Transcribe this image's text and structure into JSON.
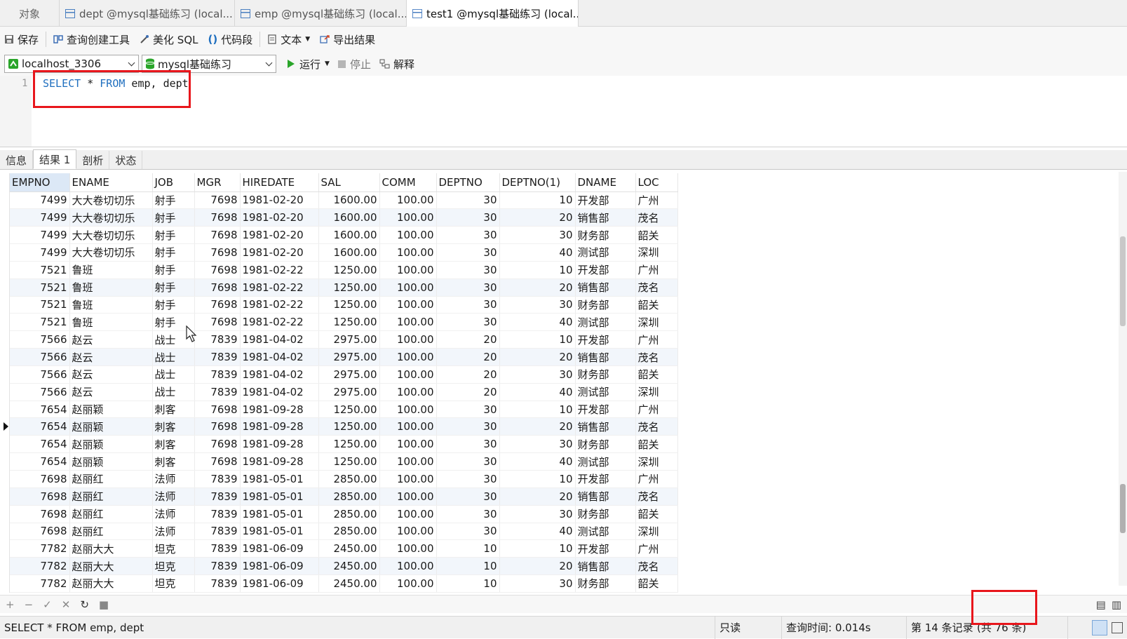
{
  "tabs": [
    {
      "label": "对象"
    },
    {
      "label": "dept @mysql基础练习 (local..."
    },
    {
      "label": "emp @mysql基础练习 (local..."
    },
    {
      "label": "test1 @mysql基础练习 (local..."
    }
  ],
  "toolbar": {
    "save": "保存",
    "query_builder": "查询创建工具",
    "beautify": "美化 SQL",
    "snippet": "代码段",
    "text": "文本",
    "export": "导出结果"
  },
  "connection": {
    "server": "localhost_3306",
    "database": "mysql基础练习",
    "run": "运行",
    "stop": "停止",
    "explain": "解释"
  },
  "editor": {
    "line_number": "1",
    "sql_keyword1": "SELECT",
    "sql_star": " * ",
    "sql_keyword2": "FROM",
    "sql_rest": " emp, dept"
  },
  "result_tabs": [
    "信息",
    "结果 1",
    "剖析",
    "状态"
  ],
  "columns": [
    "EMPNO",
    "ENAME",
    "JOB",
    "MGR",
    "HIREDATE",
    "SAL",
    "COMM",
    "DEPTNO",
    "DEPTNO(1)",
    "DNAME",
    "LOC"
  ],
  "rows": [
    [
      "7499",
      "大大卷切切乐",
      "射手",
      "7698",
      "1981-02-20",
      "1600.00",
      "100.00",
      "30",
      "10",
      "开发部",
      "广州"
    ],
    [
      "7499",
      "大大卷切切乐",
      "射手",
      "7698",
      "1981-02-20",
      "1600.00",
      "100.00",
      "30",
      "20",
      "销售部",
      "茂名"
    ],
    [
      "7499",
      "大大卷切切乐",
      "射手",
      "7698",
      "1981-02-20",
      "1600.00",
      "100.00",
      "30",
      "30",
      "财务部",
      "韶关"
    ],
    [
      "7499",
      "大大卷切切乐",
      "射手",
      "7698",
      "1981-02-20",
      "1600.00",
      "100.00",
      "30",
      "40",
      "测试部",
      "深圳"
    ],
    [
      "7521",
      "鲁班",
      "射手",
      "7698",
      "1981-02-22",
      "1250.00",
      "100.00",
      "30",
      "10",
      "开发部",
      "广州"
    ],
    [
      "7521",
      "鲁班",
      "射手",
      "7698",
      "1981-02-22",
      "1250.00",
      "100.00",
      "30",
      "20",
      "销售部",
      "茂名"
    ],
    [
      "7521",
      "鲁班",
      "射手",
      "7698",
      "1981-02-22",
      "1250.00",
      "100.00",
      "30",
      "30",
      "财务部",
      "韶关"
    ],
    [
      "7521",
      "鲁班",
      "射手",
      "7698",
      "1981-02-22",
      "1250.00",
      "100.00",
      "30",
      "40",
      "测试部",
      "深圳"
    ],
    [
      "7566",
      "赵云",
      "战士",
      "7839",
      "1981-04-02",
      "2975.00",
      "100.00",
      "20",
      "10",
      "开发部",
      "广州"
    ],
    [
      "7566",
      "赵云",
      "战士",
      "7839",
      "1981-04-02",
      "2975.00",
      "100.00",
      "20",
      "20",
      "销售部",
      "茂名"
    ],
    [
      "7566",
      "赵云",
      "战士",
      "7839",
      "1981-04-02",
      "2975.00",
      "100.00",
      "20",
      "30",
      "财务部",
      "韶关"
    ],
    [
      "7566",
      "赵云",
      "战士",
      "7839",
      "1981-04-02",
      "2975.00",
      "100.00",
      "20",
      "40",
      "测试部",
      "深圳"
    ],
    [
      "7654",
      "赵丽颖",
      "刺客",
      "7698",
      "1981-09-28",
      "1250.00",
      "100.00",
      "30",
      "10",
      "开发部",
      "广州"
    ],
    [
      "7654",
      "赵丽颖",
      "刺客",
      "7698",
      "1981-09-28",
      "1250.00",
      "100.00",
      "30",
      "20",
      "销售部",
      "茂名"
    ],
    [
      "7654",
      "赵丽颖",
      "刺客",
      "7698",
      "1981-09-28",
      "1250.00",
      "100.00",
      "30",
      "30",
      "财务部",
      "韶关"
    ],
    [
      "7654",
      "赵丽颖",
      "刺客",
      "7698",
      "1981-09-28",
      "1250.00",
      "100.00",
      "30",
      "40",
      "测试部",
      "深圳"
    ],
    [
      "7698",
      "赵丽红",
      "法师",
      "7839",
      "1981-05-01",
      "2850.00",
      "100.00",
      "30",
      "10",
      "开发部",
      "广州"
    ],
    [
      "7698",
      "赵丽红",
      "法师",
      "7839",
      "1981-05-01",
      "2850.00",
      "100.00",
      "30",
      "20",
      "销售部",
      "茂名"
    ],
    [
      "7698",
      "赵丽红",
      "法师",
      "7839",
      "1981-05-01",
      "2850.00",
      "100.00",
      "30",
      "30",
      "财务部",
      "韶关"
    ],
    [
      "7698",
      "赵丽红",
      "法师",
      "7839",
      "1981-05-01",
      "2850.00",
      "100.00",
      "30",
      "40",
      "测试部",
      "深圳"
    ],
    [
      "7782",
      "赵丽大大",
      "坦克",
      "7839",
      "1981-06-09",
      "2450.00",
      "100.00",
      "10",
      "10",
      "开发部",
      "广州"
    ],
    [
      "7782",
      "赵丽大大",
      "坦克",
      "7839",
      "1981-06-09",
      "2450.00",
      "100.00",
      "10",
      "20",
      "销售部",
      "茂名"
    ],
    [
      "7782",
      "赵丽大大",
      "坦克",
      "7839",
      "1981-06-09",
      "2450.00",
      "100.00",
      "10",
      "30",
      "财务部",
      "韶关"
    ]
  ],
  "numeric_columns": [
    0,
    3,
    5,
    6,
    7,
    8
  ],
  "selected_row_index": 13,
  "status": {
    "sql": "SELECT * FROM emp, dept",
    "readonly": "只读",
    "query_time": "查询时间: 0.014s",
    "record": "第 14 条记录",
    "total": "(共 76 条)"
  },
  "colors": {
    "accent_red": "#e8161c",
    "keyword_blue": "#1f6fbf",
    "run_green": "#2aa52a"
  }
}
